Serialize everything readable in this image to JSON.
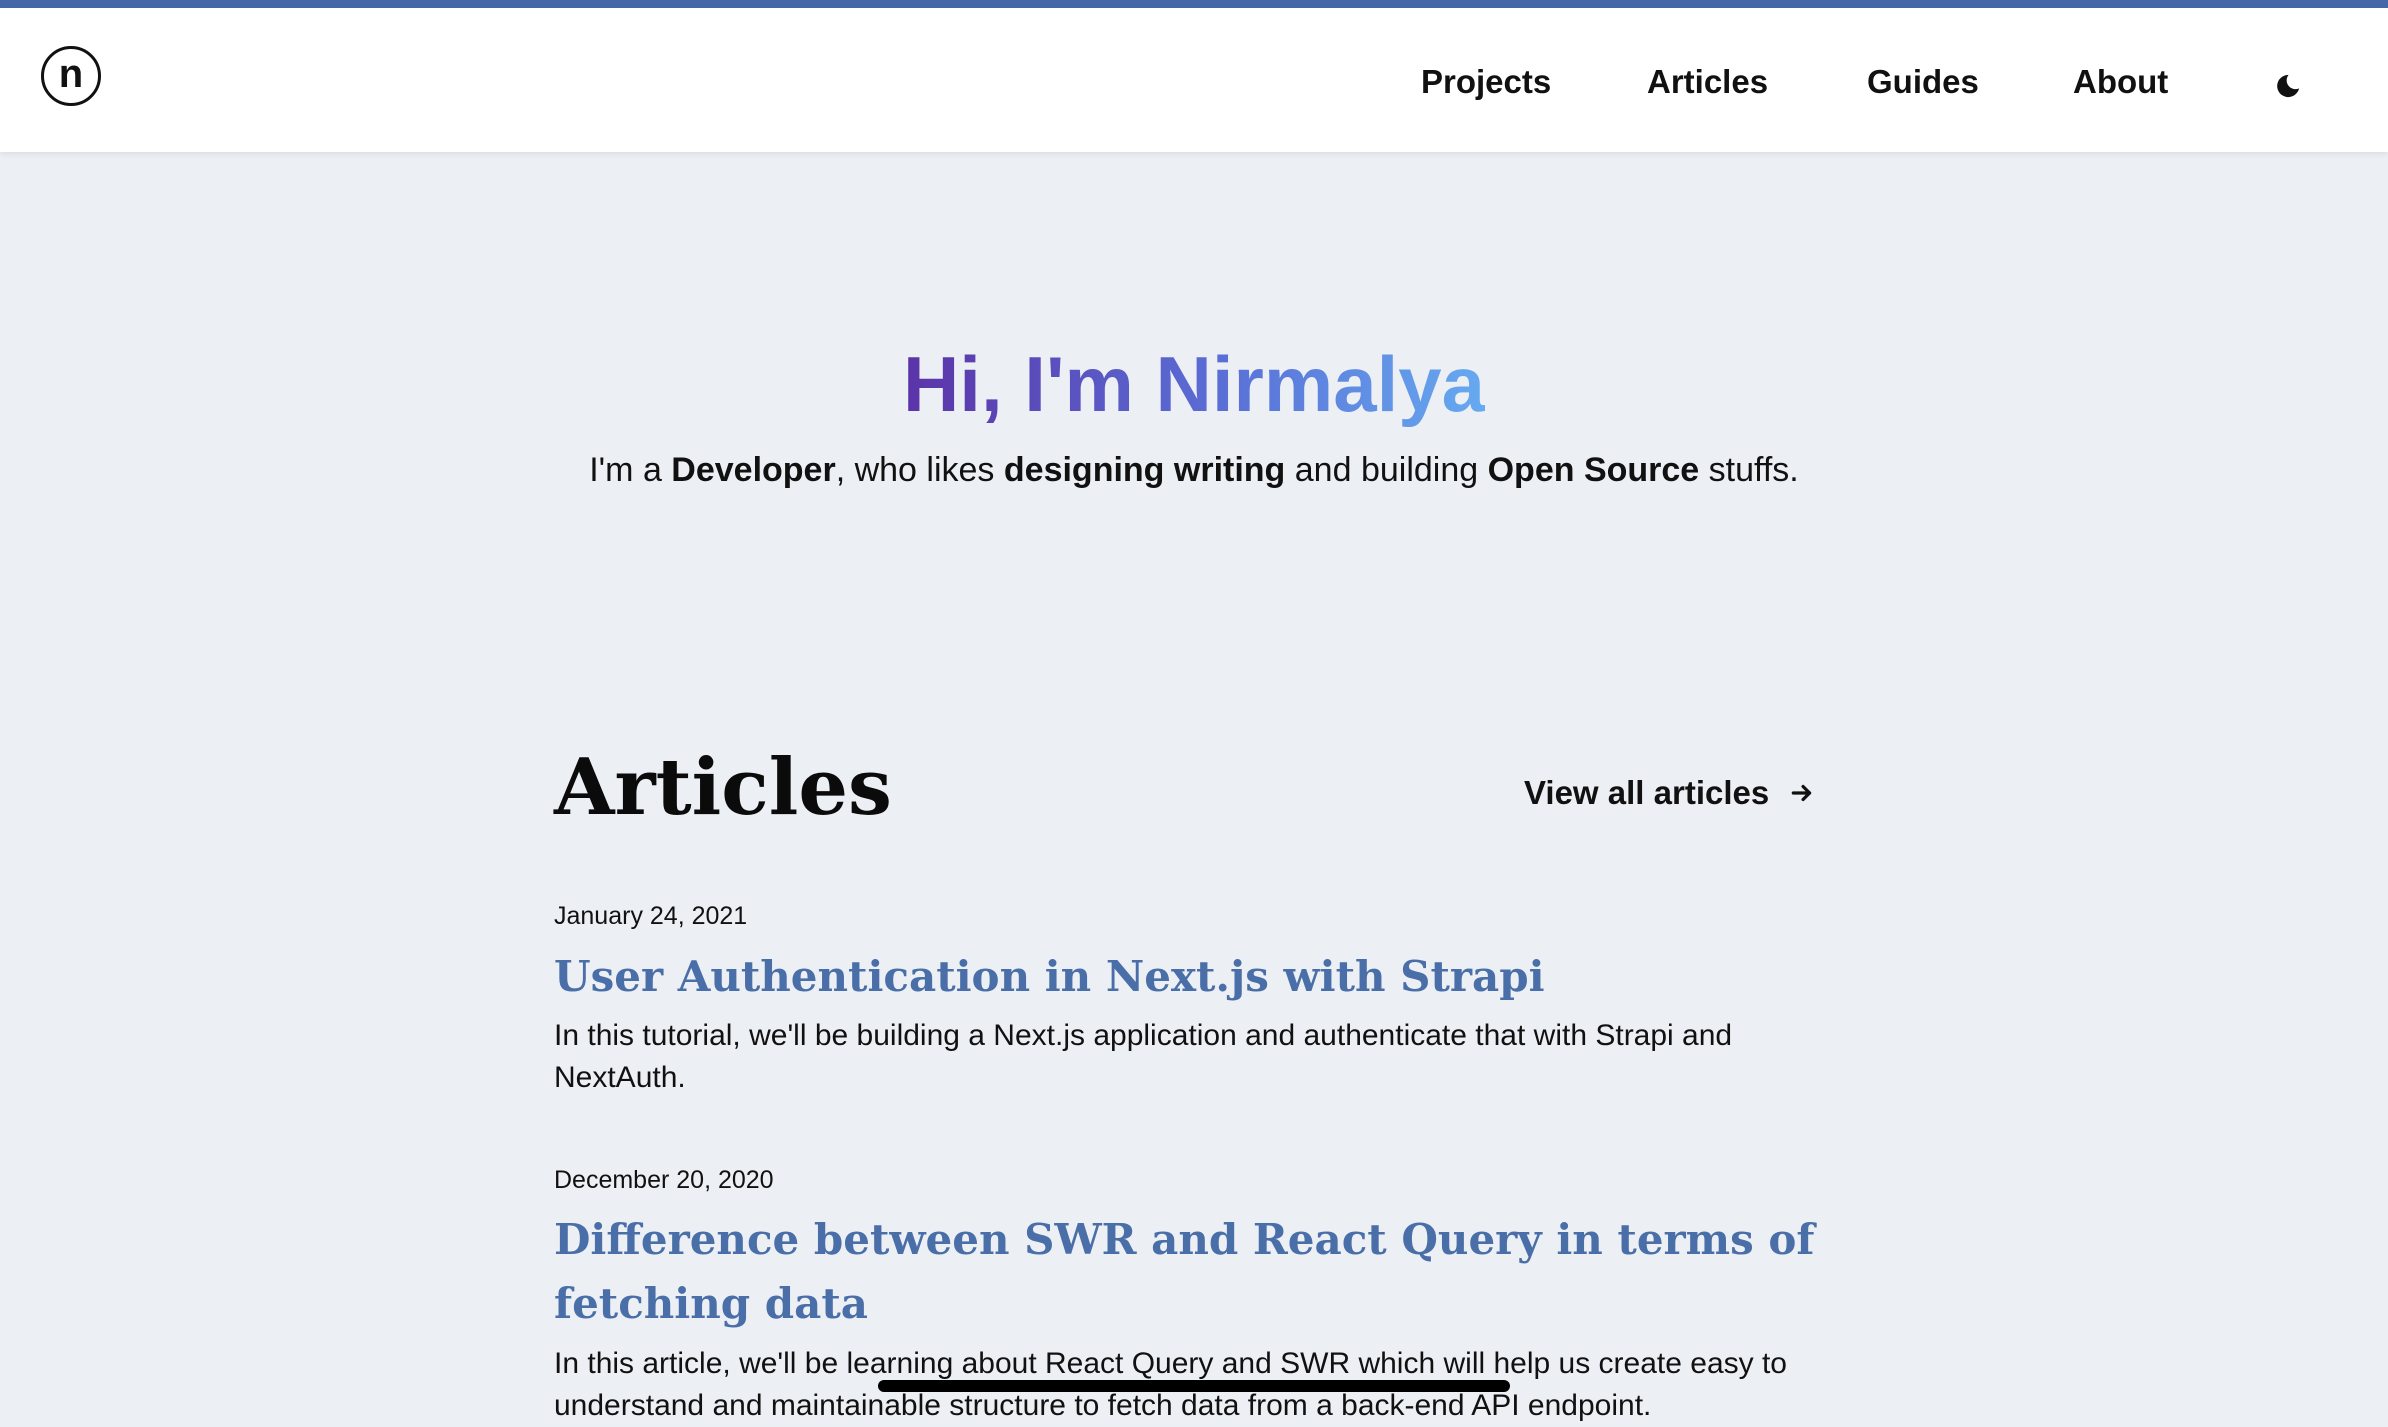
{
  "header": {
    "logo_letter": "n",
    "nav": [
      {
        "label": "Projects"
      },
      {
        "label": "Articles"
      },
      {
        "label": "Guides"
      },
      {
        "label": "About"
      }
    ],
    "theme_toggle_icon": "moon-icon"
  },
  "hero": {
    "title": "Hi, I'm Nirmalya",
    "subtitle": {
      "p1": "I'm a ",
      "b1": "Developer",
      "p2": ", who likes ",
      "b2": "designing writing",
      "p3": " and building ",
      "b3": "Open Source",
      "p4": " stuffs."
    },
    "gradient_colors": [
      "#5b33a8",
      "#5a6fd6",
      "#66aaf0"
    ]
  },
  "articles_section": {
    "title": "Articles",
    "view_all_label": "View all articles",
    "view_all_icon": "arrow-right-icon",
    "items": [
      {
        "date": "January 24, 2021",
        "title": "User Authentication in Next.js with Strapi",
        "description": "In this tutorial, we'll be building a Next.js application and authenticate that with Strapi and NextAuth."
      },
      {
        "date": "December 20, 2020",
        "title": "Difference between SWR and React Query in terms of fetching data",
        "description": "In this article, we'll be learning about React Query and SWR which will help us create easy to understand and maintainable structure to fetch data from a back-end API endpoint."
      }
    ]
  },
  "colors": {
    "accent_bar": "#4768a8",
    "background": "#eceff4",
    "article_title": "#4a6fa8"
  }
}
